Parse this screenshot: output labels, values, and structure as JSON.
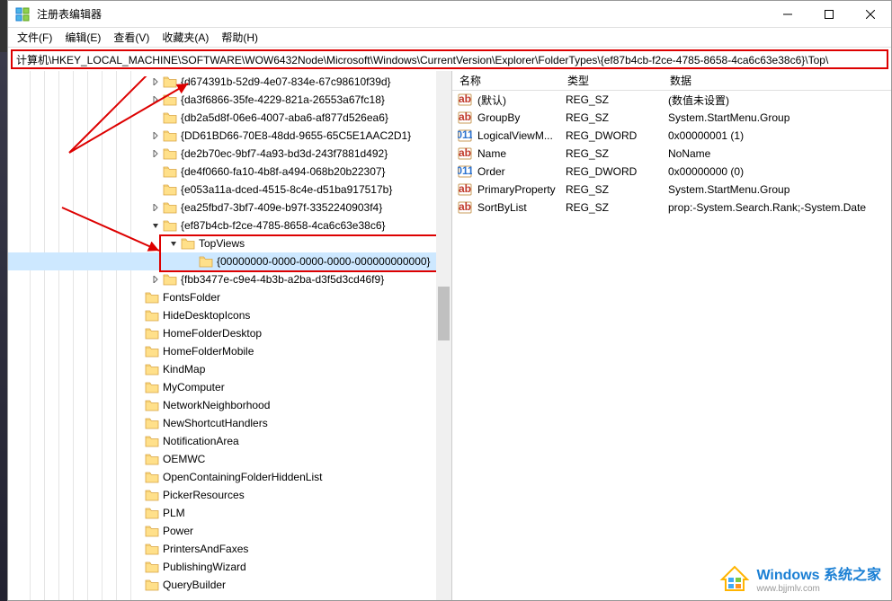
{
  "window": {
    "title": "注册表编辑器"
  },
  "menubar": {
    "file": "文件(F)",
    "edit": "编辑(E)",
    "view": "查看(V)",
    "favorites": "收藏夹(A)",
    "help": "帮助(H)"
  },
  "addressbar": {
    "path": "计算机\\HKEY_LOCAL_MACHINE\\SOFTWARE\\WOW6432Node\\Microsoft\\Windows\\CurrentVersion\\Explorer\\FolderTypes\\{ef87b4cb-f2ce-4785-8658-4ca6c63e38c6}\\Top\\"
  },
  "tree": {
    "items": [
      {
        "indent": 158,
        "exp": "right",
        "label": "{d674391b-52d9-4e07-834e-67c98610f39d}"
      },
      {
        "indent": 158,
        "exp": "right",
        "label": "{da3f6866-35fe-4229-821a-26553a67fc18}"
      },
      {
        "indent": 158,
        "exp": "none",
        "label": "{db2a5d8f-06e6-4007-aba6-af877d526ea6}"
      },
      {
        "indent": 158,
        "exp": "right",
        "label": "{DD61BD66-70E8-48dd-9655-65C5E1AAC2D1}"
      },
      {
        "indent": 158,
        "exp": "right",
        "label": "{de2b70ec-9bf7-4a93-bd3d-243f7881d492}"
      },
      {
        "indent": 158,
        "exp": "none",
        "label": "{de4f0660-fa10-4b8f-a494-068b20b22307}"
      },
      {
        "indent": 158,
        "exp": "none",
        "label": "{e053a11a-dced-4515-8c4e-d51ba917517b}"
      },
      {
        "indent": 158,
        "exp": "right",
        "label": "{ea25fbd7-3bf7-409e-b97f-3352240903f4}"
      },
      {
        "indent": 158,
        "exp": "down",
        "label": "{ef87b4cb-f2ce-4785-8658-4ca6c63e38c6}"
      },
      {
        "indent": 178,
        "exp": "down",
        "label": "TopViews"
      },
      {
        "indent": 198,
        "exp": "none",
        "label": "{00000000-0000-0000-0000-000000000000}",
        "selected": true
      },
      {
        "indent": 158,
        "exp": "right",
        "label": "{fbb3477e-c9e4-4b3b-a2ba-d3f5d3cd46f9}"
      },
      {
        "indent": 138,
        "exp": "none",
        "label": "FontsFolder"
      },
      {
        "indent": 138,
        "exp": "none",
        "label": "HideDesktopIcons"
      },
      {
        "indent": 138,
        "exp": "none",
        "label": "HomeFolderDesktop"
      },
      {
        "indent": 138,
        "exp": "none",
        "label": "HomeFolderMobile"
      },
      {
        "indent": 138,
        "exp": "none",
        "label": "KindMap"
      },
      {
        "indent": 138,
        "exp": "none",
        "label": "MyComputer"
      },
      {
        "indent": 138,
        "exp": "none",
        "label": "NetworkNeighborhood"
      },
      {
        "indent": 138,
        "exp": "none",
        "label": "NewShortcutHandlers"
      },
      {
        "indent": 138,
        "exp": "none",
        "label": "NotificationArea"
      },
      {
        "indent": 138,
        "exp": "none",
        "label": "OEMWC"
      },
      {
        "indent": 138,
        "exp": "none",
        "label": "OpenContainingFolderHiddenList"
      },
      {
        "indent": 138,
        "exp": "none",
        "label": "PickerResources"
      },
      {
        "indent": 138,
        "exp": "none",
        "label": "PLM"
      },
      {
        "indent": 138,
        "exp": "none",
        "label": "Power"
      },
      {
        "indent": 138,
        "exp": "none",
        "label": "PrintersAndFaxes"
      },
      {
        "indent": 138,
        "exp": "none",
        "label": "PublishingWizard"
      },
      {
        "indent": 138,
        "exp": "none",
        "label": "QueryBuilder"
      }
    ]
  },
  "listHeader": {
    "name": "名称",
    "type": "类型",
    "data": "数据"
  },
  "listRows": [
    {
      "icon": "sz",
      "name": "(默认)",
      "type": "REG_SZ",
      "data": "(数值未设置)"
    },
    {
      "icon": "sz",
      "name": "GroupBy",
      "type": "REG_SZ",
      "data": "System.StartMenu.Group"
    },
    {
      "icon": "dw",
      "name": "LogicalViewM...",
      "type": "REG_DWORD",
      "data": "0x00000001 (1)"
    },
    {
      "icon": "sz",
      "name": "Name",
      "type": "REG_SZ",
      "data": "NoName"
    },
    {
      "icon": "dw",
      "name": "Order",
      "type": "REG_DWORD",
      "data": "0x00000000 (0)"
    },
    {
      "icon": "sz",
      "name": "PrimaryProperty",
      "type": "REG_SZ",
      "data": "System.StartMenu.Group"
    },
    {
      "icon": "sz",
      "name": "SortByList",
      "type": "REG_SZ",
      "data": "prop:-System.Search.Rank;-System.Date"
    }
  ],
  "watermark": {
    "line1": "Windows 系统之家",
    "line2": "www.bjjmlv.com"
  }
}
